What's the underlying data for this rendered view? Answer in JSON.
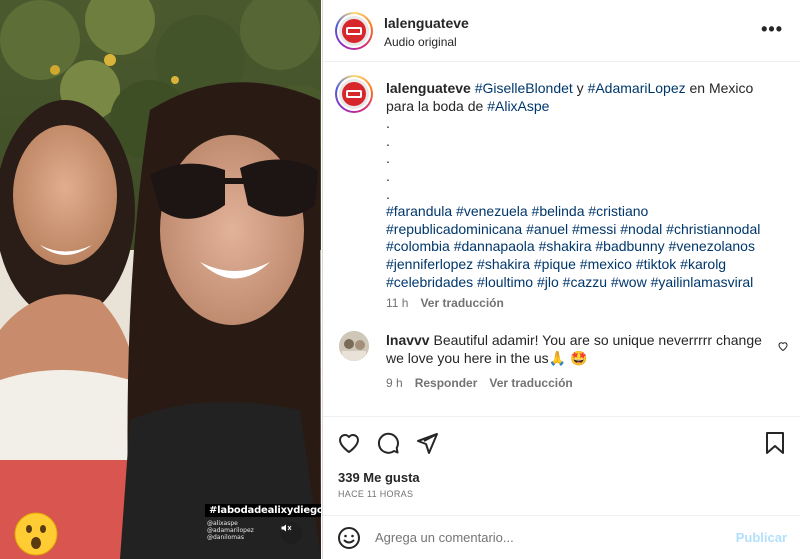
{
  "media": {
    "hashtag_sticker": "#labodadealixydiego",
    "mentions": [
      "@alixaspe",
      "@adamarilopez",
      "@danilomas"
    ],
    "emoji_sticker": "face-with-open-mouth",
    "mute_icon": "speaker-muted-icon"
  },
  "header": {
    "username": "lalenguateve",
    "audio": "Audio original",
    "more_icon": "more-horizontal-icon"
  },
  "caption": {
    "username": "lalenguateve",
    "text_parts": [
      "#GiselleBlondet",
      " y ",
      "#AdamariLopez",
      " en Mexico para la boda de ",
      "#AlixAspe"
    ],
    "dots": [
      ".",
      ".",
      ".",
      ".",
      "."
    ],
    "hashtags": "#farandula #venezuela #belinda #cristiano #republicadominicana #anuel #messi #nodal #christiannodal #colombia #dannapaola #shakira #badbunny #venezolanos #jenniferlopez #shakira #pique #mexico #tiktok #karolg #celebridades #loultimo #jlo #cazzu #wow #yailinlamasviral",
    "time": "11 h",
    "translate": "Ver traducción"
  },
  "comment": {
    "username": "lnavvv",
    "text": "Beautiful adamir! You are so unique neverrrrr change we love you here in the us🙏 🤩",
    "time": "9 h",
    "reply": "Responder",
    "translate": "Ver traducción"
  },
  "actions": {
    "like_icon": "heart-icon",
    "comment_icon": "comment-icon",
    "share_icon": "paper-plane-icon",
    "save_icon": "bookmark-icon"
  },
  "likes": "339 Me gusta",
  "time_ago": "HACE 11 HORAS",
  "add_comment": {
    "placeholder": "Agrega un comentario...",
    "post": "Publicar",
    "emoji_icon": "smiley-icon"
  },
  "colors": {
    "link": "#00376b",
    "muted": "#737373",
    "post_disabled": "#b2dffc"
  }
}
